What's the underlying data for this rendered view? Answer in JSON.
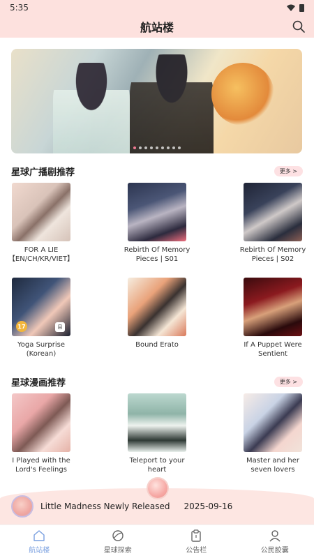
{
  "status": {
    "time": "5:35"
  },
  "header": {
    "title": "航站楼"
  },
  "sections": [
    {
      "title": "星球广播剧推荐",
      "more": "更多 >",
      "items": [
        {
          "title": "FOR A LIE 【EN/CH/KR/VIET】"
        },
        {
          "title": "Rebirth Of Memory Pieces | S01"
        },
        {
          "title": "Rebirth Of Memory Pieces | S02"
        },
        {
          "title": "Yoga Surprise (Korean)",
          "badge_age": "17",
          "badge_icon": "目"
        },
        {
          "title": "Bound Erato"
        },
        {
          "title": "If A Puppet Were Sentient"
        }
      ]
    },
    {
      "title": "星球漫画推荐",
      "more": "更多 >",
      "items": [
        {
          "title": "I Played with the Lord's Feelings"
        },
        {
          "title": "Teleport to your heart"
        },
        {
          "title": "Master and her seven lovers"
        }
      ]
    }
  ],
  "now_playing": {
    "title": "Little Madness Newly Released",
    "date": "2025-09-16"
  },
  "tabs": [
    {
      "label": "航站楼",
      "icon": "home-icon",
      "active": true
    },
    {
      "label": "星球探索",
      "icon": "planet-icon",
      "active": false
    },
    {
      "label": "公告栏",
      "icon": "clipboard-icon",
      "active": false
    },
    {
      "label": "公民胶囊",
      "icon": "user-icon",
      "active": false
    }
  ],
  "colors": {
    "accent": "#fde1de",
    "active_tab": "#7aa0e0",
    "dot_active": "#ef7a93"
  }
}
